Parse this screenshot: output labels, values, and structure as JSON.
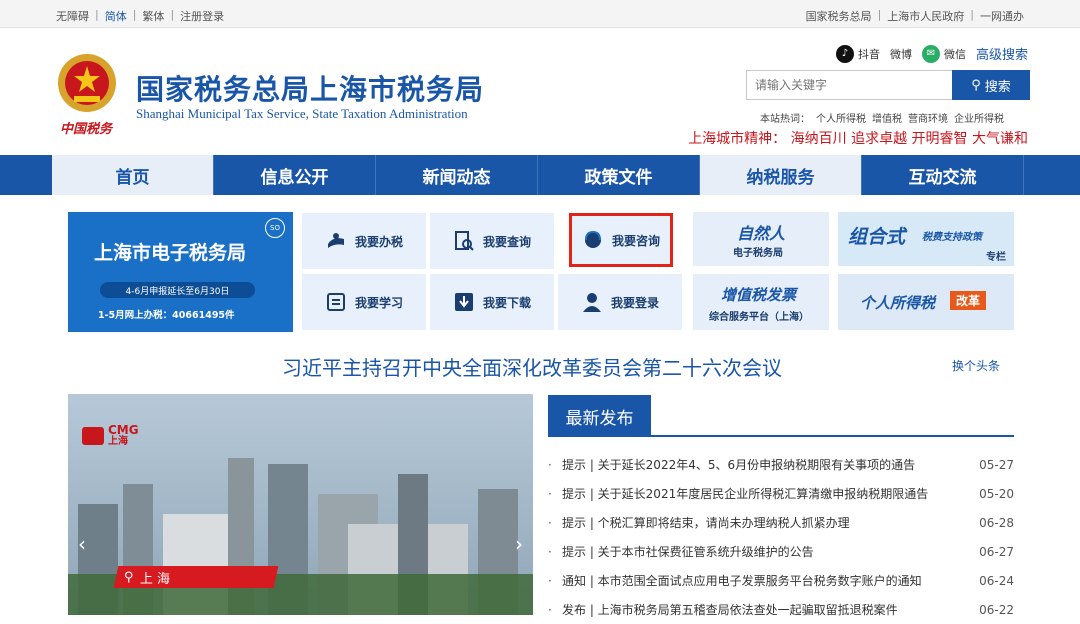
{
  "topbar": {
    "left": [
      {
        "label": "无障碍",
        "active": false
      },
      {
        "label": "简体",
        "active": true
      },
      {
        "label": "繁体",
        "active": false
      },
      {
        "label": "注册登录",
        "active": false
      }
    ],
    "right": [
      "国家税务总局",
      "上海市人民政府",
      "一网通办"
    ]
  },
  "header": {
    "title_cn": "国家税务总局上海市税务局",
    "title_en": "Shanghai Municipal Tax Service, State Taxation Administration",
    "brand_mark": "中国税务",
    "social": {
      "douyin": "抖音",
      "weibo": "微博",
      "wechat": "微信",
      "advanced_search": "高级搜索"
    },
    "search": {
      "placeholder": "请输入关键字",
      "button": "搜索"
    },
    "hot": {
      "label": "本站热词：",
      "items": [
        "个人所得税",
        "增值税",
        "营商环境",
        "企业所得税"
      ]
    },
    "spirit": "上海城市精神：  海纳百川 追求卓越 开明睿智 大气谦和"
  },
  "nav": [
    "首页",
    "信息公开",
    "新闻动态",
    "政策文件",
    "纳税服务",
    "互动交流"
  ],
  "etax": {
    "title": "上海市电子税务局",
    "pill": "4-6月申报延长至6月30日",
    "note": "1-5月网上办税：40661495件",
    "badge": "SO"
  },
  "services": [
    "我要办税",
    "我要查询",
    "我要咨询",
    "我要学习",
    "我要下载",
    "我要登录"
  ],
  "promos": {
    "natural_big": "自然人",
    "natural_small": "电子税务局",
    "combo_big": "组合式",
    "combo_mid": "税费支持政策",
    "combo_small": "专栏",
    "vat_big": "增值税发票",
    "vat_small": "综合服务平台（上海）",
    "iit_big": "个人所得税",
    "iit_tag": "改革"
  },
  "headline": {
    "text": "习近平主持召开中央全面深化改革委员会第二十六次会议",
    "change": "换个头条"
  },
  "video": {
    "brand": "CMG",
    "brand_sub": "上海",
    "location": "上  海"
  },
  "latest": {
    "title": "最新发布",
    "items": [
      {
        "text": "提示 | 关于延长2022年4、5、6月份申报纳税期限有关事项的通告",
        "date": "05-27"
      },
      {
        "text": "提示 | 关于延长2021年度居民企业所得税汇算清缴申报纳税期限通告",
        "date": "05-20"
      },
      {
        "text": "提示 | 个税汇算即将结束，请尚未办理纳税人抓紧办理",
        "date": "06-28"
      },
      {
        "text": "提示 | 关于本市社保费征管系统升级维护的公告",
        "date": "06-27"
      },
      {
        "text": "通知 | 本市范围全面试点应用电子发票服务平台税务数字账户的通知",
        "date": "06-24"
      },
      {
        "text": "发布 | 上海市税务局第五稽查局依法查处一起骗取留抵退税案件",
        "date": "06-22"
      }
    ]
  },
  "colors": {
    "primary": "#1a56a8",
    "accent_red": "#c8161d",
    "nav_active_bg": "#e8eef7",
    "service_bg": "#e8f1fb"
  }
}
